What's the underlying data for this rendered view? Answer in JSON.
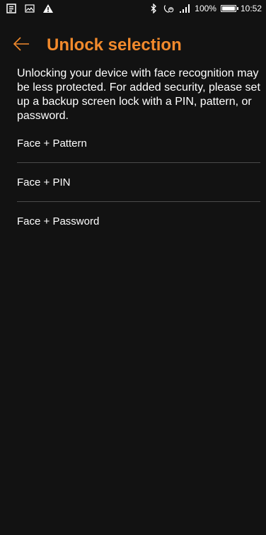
{
  "status_bar": {
    "left_icons": [
      "notification-icon",
      "image-icon",
      "warning-icon"
    ],
    "right_icons": [
      "bluetooth-icon",
      "wifi-calling-icon",
      "signal-icon",
      "battery-icon"
    ],
    "battery_percent": "100%",
    "time": "10:52"
  },
  "header": {
    "back_icon": "arrow-left-icon",
    "title": "Unlock selection",
    "title_color": "#f28a2c"
  },
  "main": {
    "description": "Unlocking your device with face recognition may be less protected. For added security, please set up a backup screen lock with a PIN, pattern, or password.",
    "options": [
      {
        "label": "Face + Pattern"
      },
      {
        "label": "Face + PIN"
      },
      {
        "label": "Face + Password"
      }
    ]
  }
}
